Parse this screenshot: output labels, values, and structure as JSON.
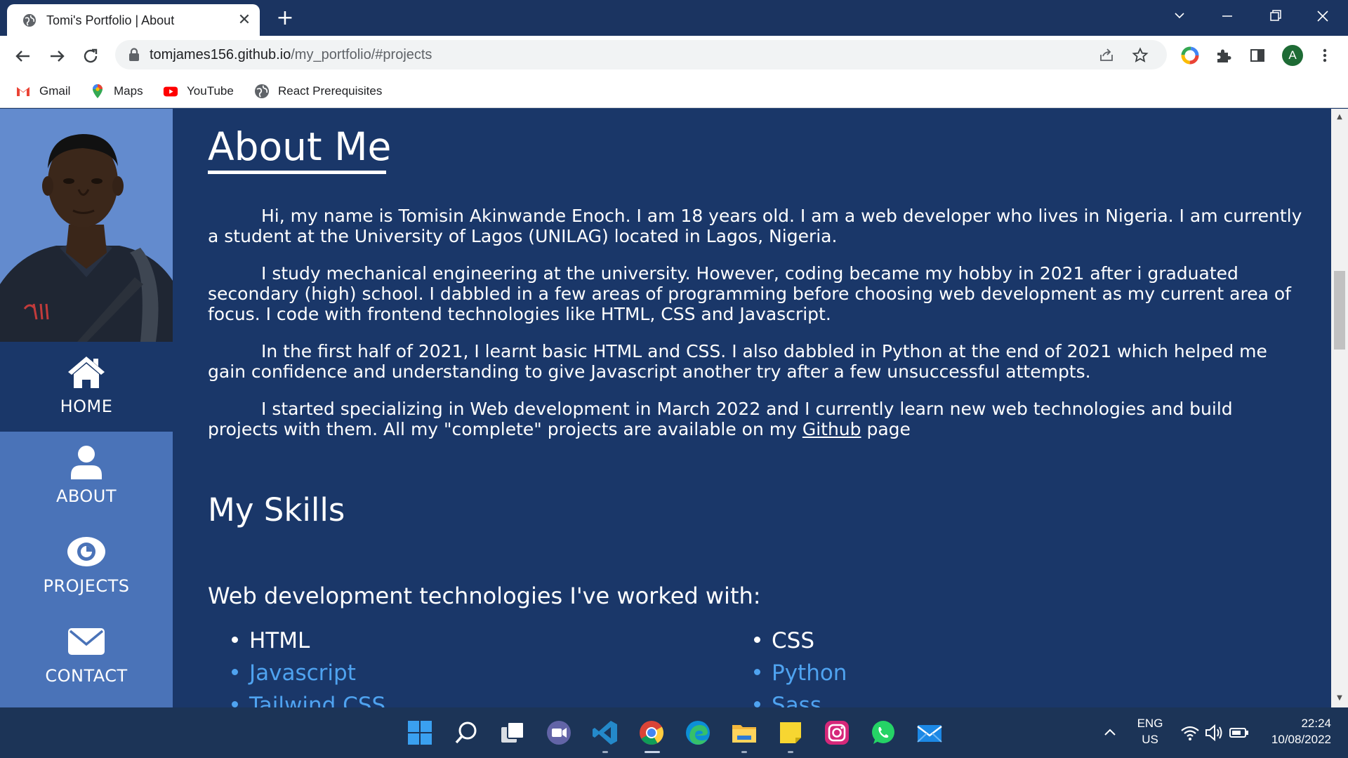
{
  "browser": {
    "tab_title": "Tomi's Portfolio | About",
    "url_host": "tomjames156.github.io",
    "url_path": "/my_portfolio/#projects",
    "profile_initial": "A",
    "bookmarks": [
      {
        "label": "Gmail",
        "icon": "gmail-icon"
      },
      {
        "label": "Maps",
        "icon": "maps-icon"
      },
      {
        "label": "YouTube",
        "icon": "youtube-icon"
      },
      {
        "label": "React Prerequisites",
        "icon": "globe-icon"
      }
    ]
  },
  "sidebar": {
    "nav": [
      {
        "label": "HOME",
        "icon": "home-icon",
        "active": true
      },
      {
        "label": "ABOUT",
        "icon": "user-icon",
        "active": false
      },
      {
        "label": "PROJECTS",
        "icon": "eye-icon",
        "active": false
      },
      {
        "label": "CONTACT",
        "icon": "envelope-icon",
        "active": false
      }
    ]
  },
  "about": {
    "heading": "About Me",
    "paragraphs": [
      "Hi, my name is Tomisin Akinwande Enoch. I am 18 years old. I am a web developer who lives in Nigeria. I am currently a student at the University of Lagos (UNILAG) located in Lagos, Nigeria.",
      "I study mechanical engineering at the university. However, coding became my hobby in 2021 after i graduated secondary (high) school. I dabbled in a few areas of programming before choosing web development as my current area of focus. I code with frontend technologies like HTML, CSS and Javascript.",
      "In the first half of 2021, I learnt basic HTML and CSS. I also dabbled in Python at the end of 2021 which helped me gain confidence and understanding to give Javascript another try after a few unsuccessful attempts."
    ],
    "last_paragraph_before_link": "I started specializing in Web development in March 2022 and I currently learn new web technologies and build projects with them. All my \"complete\" projects are available on my ",
    "github_link": "Github",
    "last_paragraph_after_link": " page"
  },
  "skills": {
    "heading": "My Skills",
    "subheading": "Web development technologies I've worked with:",
    "left_column": [
      "HTML",
      "Javascript",
      "Tailwind CSS"
    ],
    "right_column": [
      "CSS",
      "Python",
      "Sass"
    ]
  },
  "taskbar": {
    "language": "ENG",
    "region": "US",
    "time": "22:24",
    "date": "10/08/2022"
  },
  "colors": {
    "page_background": "#1a3769",
    "sidebar_background": "#4a73b8",
    "accent_blue": "#4fa3f0"
  }
}
